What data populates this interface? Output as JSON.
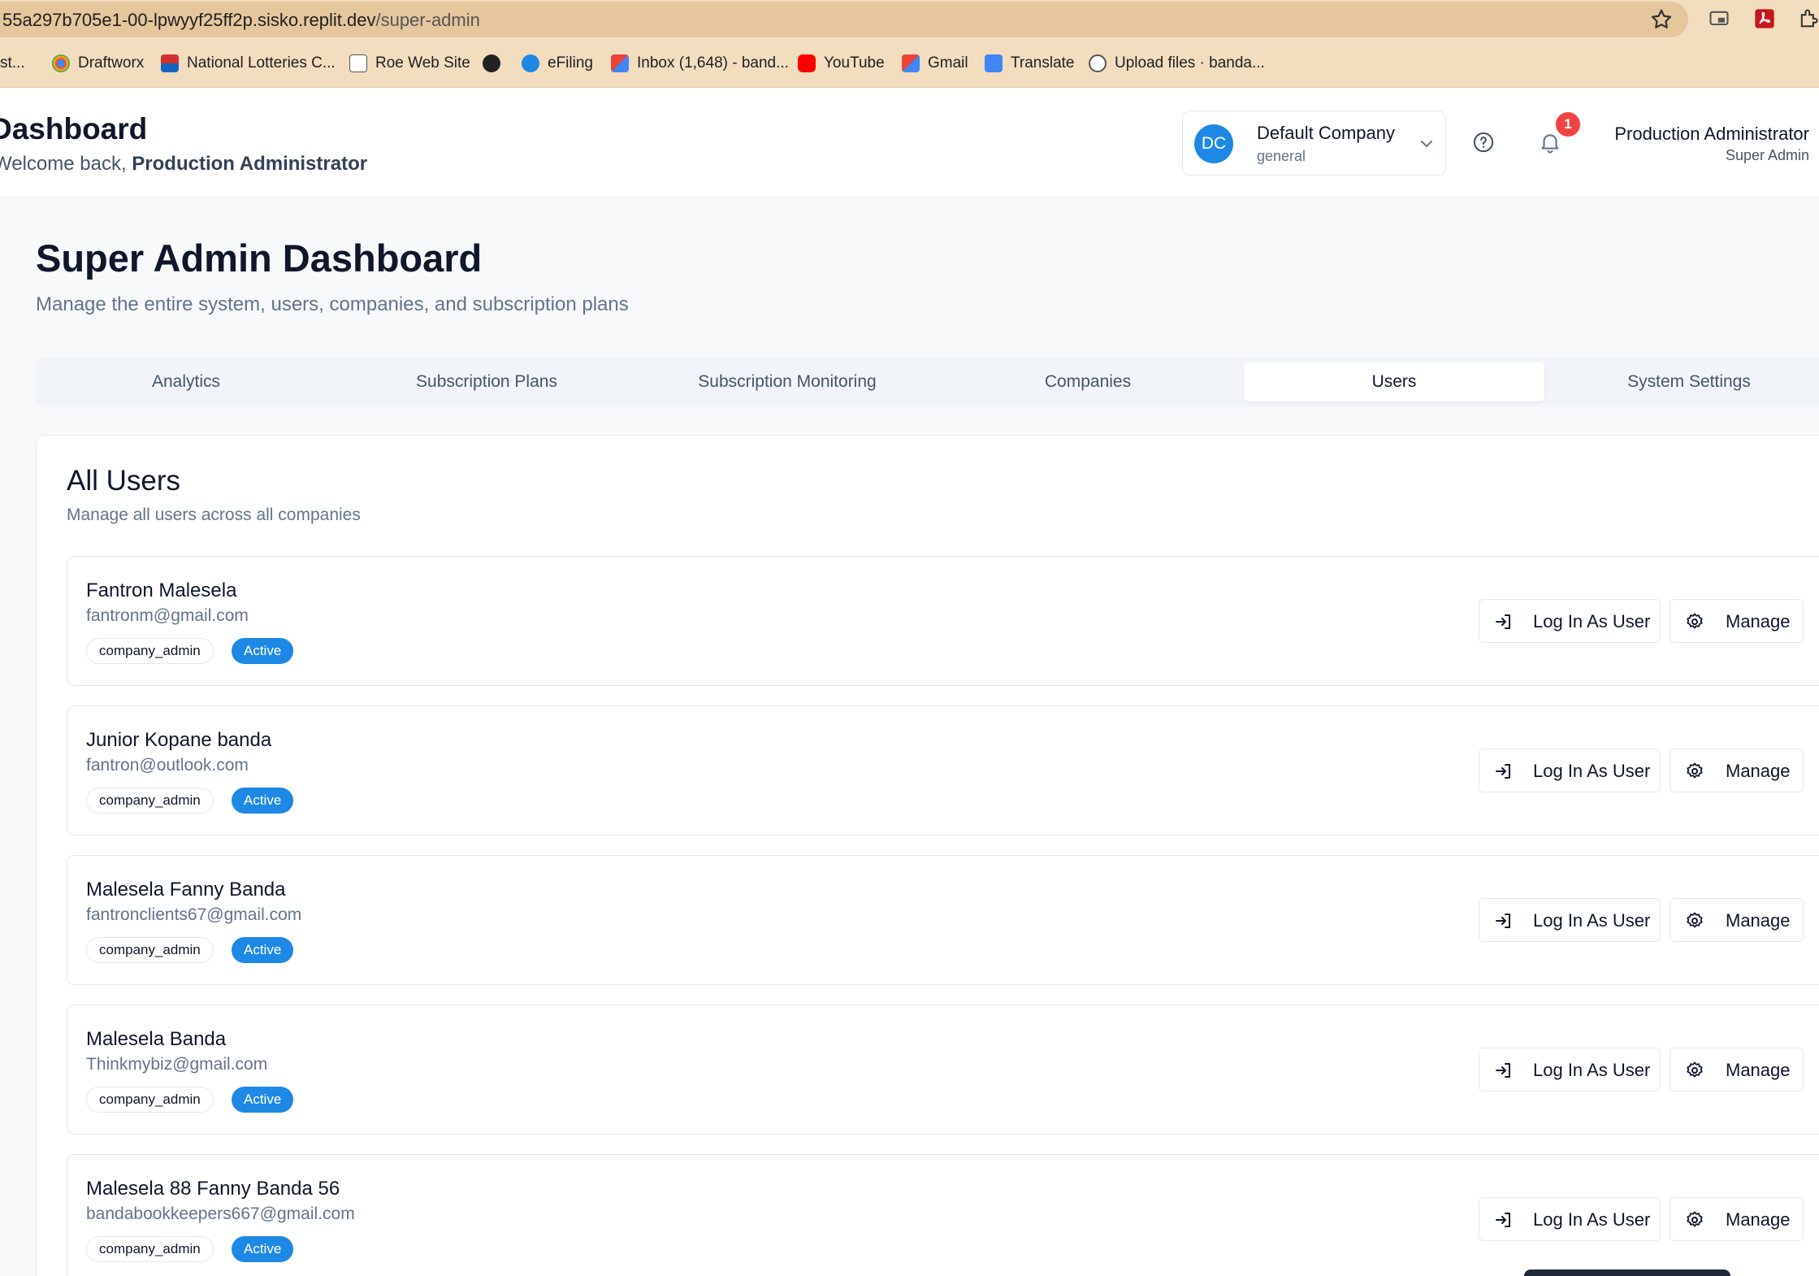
{
  "browser": {
    "url_host": "55a297b705e1-00-lpwyyf25ff2p.sisko.replit.dev",
    "url_path": "/super-admin",
    "bookmarks": [
      "st...",
      "Draftworx",
      "National Lotteries C...",
      "Roe Web Site",
      "",
      "eFiling",
      "Inbox (1,648) - band...",
      "YouTube",
      "Gmail",
      "Translate",
      "Upload files · banda..."
    ]
  },
  "header": {
    "title": "Dashboard",
    "welcome_prefix": "Welcome back, ",
    "welcome_name": "Production Administrator",
    "company_initials": "DC",
    "company_name": "Default Company",
    "company_type": "general",
    "notification_count": "1",
    "user_name": "Production Administrator",
    "user_role": "Super Admin"
  },
  "page": {
    "title": "Super Admin Dashboard",
    "subtitle": "Manage the entire system, users, companies, and subscription plans"
  },
  "tabs": [
    "Analytics",
    "Subscription Plans",
    "Subscription Monitoring",
    "Companies",
    "Users",
    "System Settings"
  ],
  "active_tab": "Users",
  "users_card": {
    "title": "All Users",
    "subtitle": "Manage all users across all companies",
    "login_label": "Log In As User",
    "manage_label": "Manage",
    "users": [
      {
        "name": "Fantron Malesela",
        "email": "fantronm@gmail.com",
        "role": "company_admin",
        "status": "Active"
      },
      {
        "name": "Junior Kopane banda",
        "email": "fantron@outlook.com",
        "role": "company_admin",
        "status": "Active"
      },
      {
        "name": "Malesela Fanny Banda",
        "email": "fantronclients67@gmail.com",
        "role": "company_admin",
        "status": "Active"
      },
      {
        "name": "Malesela Banda",
        "email": "Thinkmybiz@gmail.com",
        "role": "company_admin",
        "status": "Active"
      },
      {
        "name": "Malesela 88 Fanny Banda 56",
        "email": "bandabookkeepers667@gmail.com",
        "role": "company_admin",
        "status": "Active"
      }
    ]
  },
  "colors": {
    "accent": "#1e88e5",
    "badge_red": "#ef4444",
    "chrome_bar": "#f2ddbf"
  }
}
